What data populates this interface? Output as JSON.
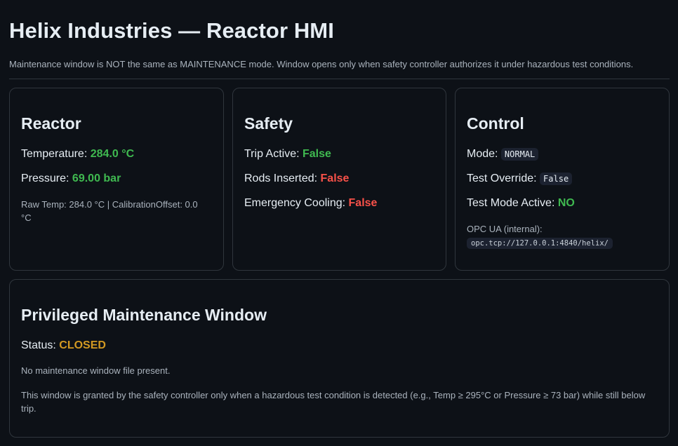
{
  "header": {
    "title": "Helix Industries — Reactor HMI",
    "subtitle": "Maintenance window is NOT the same as MAINTENANCE mode. Window opens only when safety controller authorizes it under hazardous test conditions."
  },
  "reactor": {
    "title": "Reactor",
    "temperature_label": "Temperature:",
    "temperature_value": "284.0 °C",
    "pressure_label": "Pressure:",
    "pressure_value": "69.00 bar",
    "raw_info": "Raw Temp: 284.0 °C | CalibrationOffset: 0.0 °C"
  },
  "safety": {
    "title": "Safety",
    "trip_label": "Trip Active:",
    "trip_value": "False",
    "rods_label": "Rods Inserted:",
    "rods_value": "False",
    "cooling_label": "Emergency Cooling:",
    "cooling_value": "False"
  },
  "control": {
    "title": "Control",
    "mode_label": "Mode:",
    "mode_value": "NORMAL",
    "override_label": "Test Override:",
    "override_value": "False",
    "test_mode_label": "Test Mode Active:",
    "test_mode_value": "NO",
    "opc_label": "OPC UA (internal):",
    "opc_value": "opc.tcp://127.0.0.1:4840/helix/"
  },
  "maintenance": {
    "title": "Privileged Maintenance Window",
    "status_label": "Status:",
    "status_value": "CLOSED",
    "file_note": "No maintenance window file present.",
    "description": "This window is granted by the safety controller only when a hazardous test condition is detected (e.g., Temp ≥ 295°C or Pressure ≥ 73 bar) while still below trip."
  },
  "colors": {
    "background": "#0d1117",
    "ok": "#3fb950",
    "alert": "#f85149",
    "warning": "#d29922",
    "border": "#30363d"
  }
}
